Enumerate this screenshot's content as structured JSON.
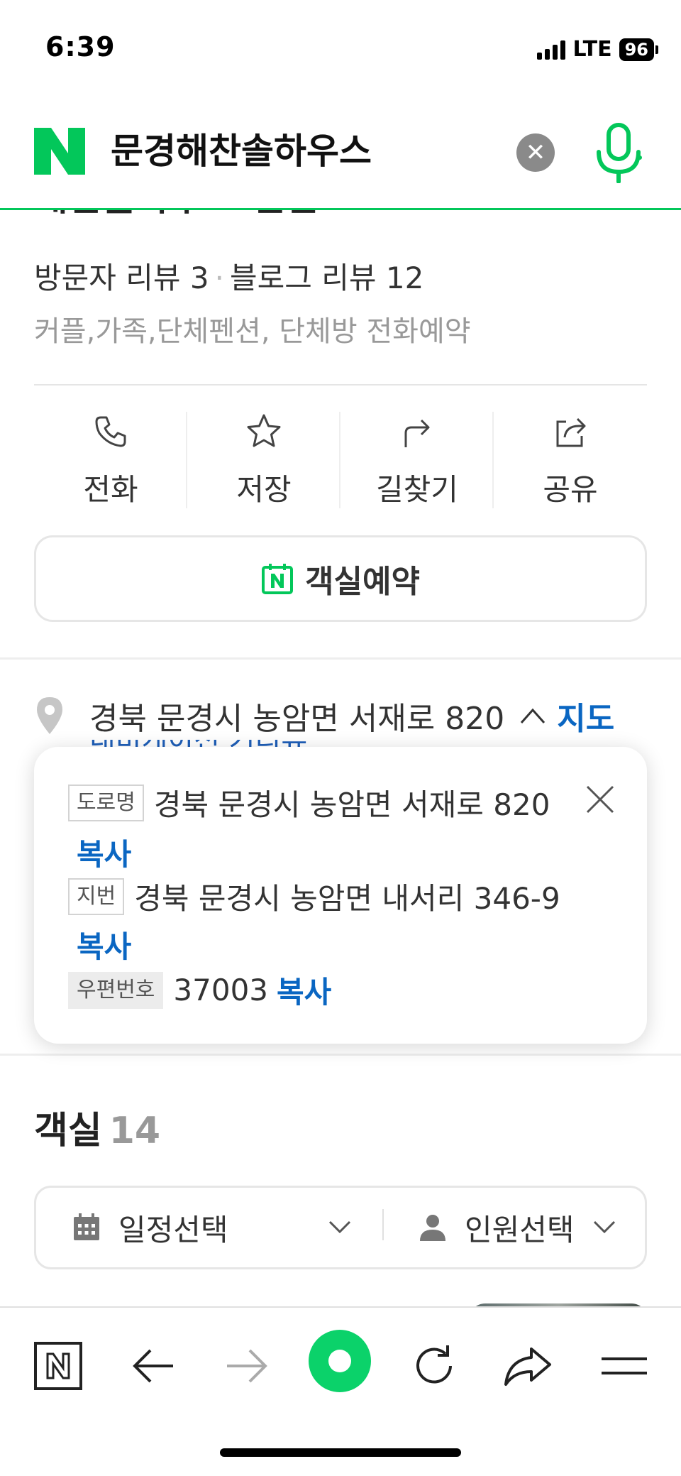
{
  "status_bar": {
    "time": "6:39",
    "network": "LTE",
    "battery": "96"
  },
  "search": {
    "query": "문경해찬솔하우스"
  },
  "place": {
    "title_cut": "해찬솔하우스 펜션",
    "visitor_reviews": "방문자 리뷰 3",
    "blog_reviews": "블로그 리뷰 12",
    "description": "커플,가족,단체펜션, 단체방 전화예약"
  },
  "actions": [
    {
      "label": "전화",
      "icon": "phone-icon"
    },
    {
      "label": "저장",
      "icon": "star-icon"
    },
    {
      "label": "길찾기",
      "icon": "directions-icon"
    },
    {
      "label": "공유",
      "icon": "share-icon"
    }
  ],
  "booking": {
    "label": "객실예약"
  },
  "address": {
    "main": "경북 문경시 농암면 서재로 820",
    "map_link": "지도",
    "ghost_text": "내비게이션 거리뷰"
  },
  "address_popup": {
    "road_tag": "도로명",
    "road_address": "경북 문경시 농암면 서재로 820",
    "lot_tag": "지번",
    "lot_address": "경북 문경시 농암면 내서리 346-9",
    "postal_tag": "우편번호",
    "postal_code": "37003",
    "copy_label": "복사"
  },
  "rooms": {
    "title": "객실",
    "count": "14",
    "date_filter": "일정선택",
    "people_filter": "인원선택"
  },
  "colors": {
    "naver_green": "#03c75a",
    "link_blue": "#0a66c2"
  }
}
